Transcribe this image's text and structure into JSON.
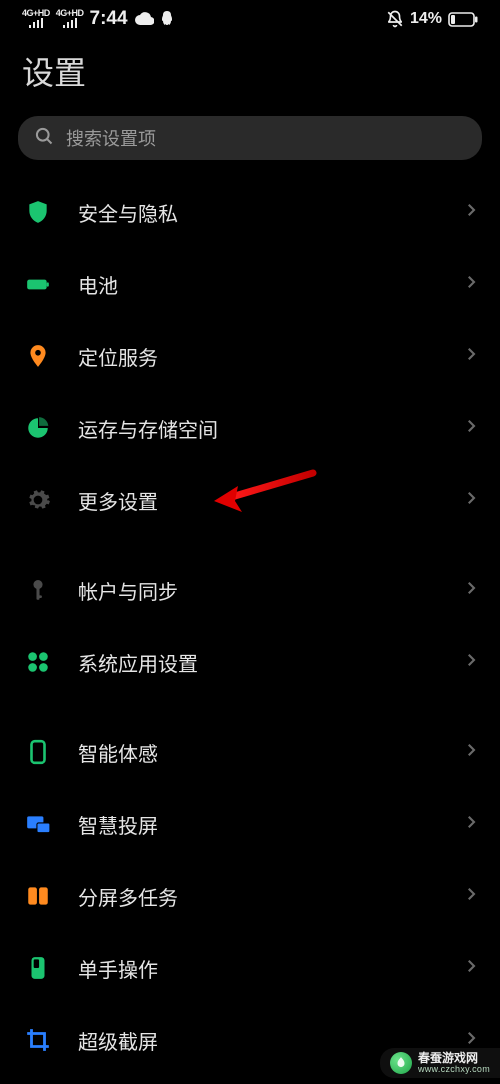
{
  "status": {
    "signal_sup1": "4G+HD",
    "signal_sup2": "4G+HD",
    "time": "7:44",
    "battery_pct": "14%"
  },
  "page_title": "设置",
  "search": {
    "placeholder": "搜索设置项"
  },
  "groups": [
    {
      "items": [
        {
          "key": "security",
          "icon": "shield",
          "icon_color": "#1bc470",
          "label": "安全与隐私"
        },
        {
          "key": "battery",
          "icon": "battery",
          "icon_color": "#1bc470",
          "label": "电池"
        },
        {
          "key": "location",
          "icon": "pin",
          "icon_color": "#ff8a1f",
          "label": "定位服务"
        },
        {
          "key": "storage",
          "icon": "piechart",
          "icon_color": "#1bc470",
          "label": "运存与存储空间"
        },
        {
          "key": "more",
          "icon": "gear",
          "icon_color": "#4a4a4a",
          "label": "更多设置",
          "annotated": true
        }
      ]
    },
    {
      "items": [
        {
          "key": "accounts",
          "icon": "key",
          "icon_color": "#4a4a4a",
          "label": "帐户与同步"
        },
        {
          "key": "sysapps",
          "icon": "grid4",
          "icon_color": "#1bc470",
          "label": "系统应用设置"
        }
      ]
    },
    {
      "items": [
        {
          "key": "gesture",
          "icon": "phone-outline",
          "icon_color": "#1bc470",
          "label": "智能体感"
        },
        {
          "key": "cast",
          "icon": "cast",
          "icon_color": "#2a7fff",
          "label": "智慧投屏"
        },
        {
          "key": "split",
          "icon": "split",
          "icon_color": "#ff8a1f",
          "label": "分屏多任务"
        },
        {
          "key": "onehand",
          "icon": "phone-fill",
          "icon_color": "#1bc470",
          "label": "单手操作"
        },
        {
          "key": "screenshot",
          "icon": "crop",
          "icon_color": "#2a7fff",
          "label": "超级截屏"
        }
      ]
    }
  ],
  "watermark": {
    "title": "春蚕游戏网",
    "sub": "www.czchxy.com"
  }
}
